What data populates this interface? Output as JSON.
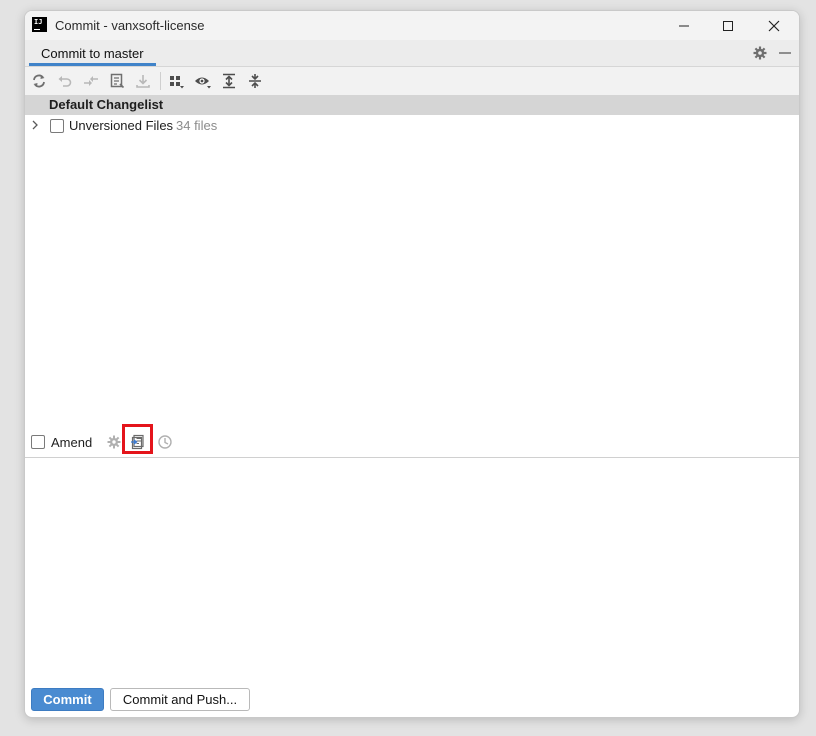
{
  "window": {
    "title": "Commit - vanxsoft-license",
    "app_icon_text": "IJ"
  },
  "tabs": [
    {
      "label": "Commit to master",
      "active": true
    }
  ],
  "toolbar": {
    "icons": [
      "refresh-icon",
      "rollback-icon",
      "show-diff-icon",
      "shelve-icon",
      "download-icon",
      "group-by-icon",
      "eye-icon",
      "expand-all-icon",
      "collapse-all-icon"
    ]
  },
  "changelist": {
    "name": "Default Changelist",
    "items": [
      {
        "label": "Unversioned Files",
        "count": "34 files",
        "checked": false,
        "expanded": false
      }
    ]
  },
  "amend": {
    "label": "Amend",
    "checked": false
  },
  "commit_message": {
    "value": ""
  },
  "buttons": {
    "commit": "Commit",
    "commit_and_push": "Commit and Push..."
  },
  "colors": {
    "accent": "#4083c9",
    "primary_button": "#4a8bd1",
    "highlight": "#e4141b",
    "changelist_header": "#d5d5d5"
  }
}
